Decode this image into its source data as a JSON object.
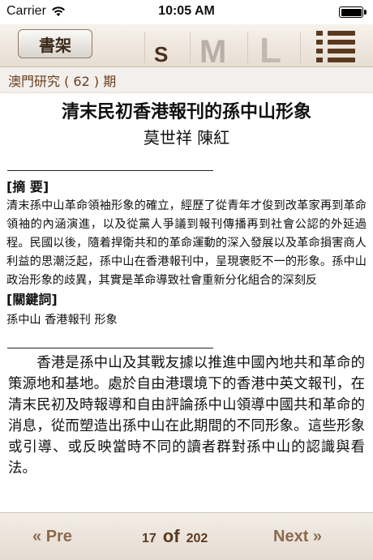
{
  "status": {
    "carrier": "Carrier",
    "time": "10:05 AM"
  },
  "toolbar": {
    "shelf_label": "書架",
    "size_small": "S",
    "size_medium": "M",
    "size_large": "L"
  },
  "breadcrumb": "澳門研究 ( 62 ) 期",
  "article": {
    "title": "清末民初香港報刊的孫中山形象",
    "authors": "莫世祥  陳紅",
    "abstract_heading": "[摘  要]",
    "abstract": "清末孫中山革命領袖形象的確立，經歷了從青年才俊到改革家再到革命領袖的內涵演進，以及從黨人爭議到報刊傳播再到社會公認的外延過程。民國以後，隨着捍衛共和的革命運動的深入發展以及革命損害商人利益的思潮泛起，孫中山在香港報刊中，呈現褒貶不一的形象。孫中山政治形象的歧異，其實是革命導致社會重新分化組合的深刻反",
    "keywords_heading": "[關鍵詞]",
    "keywords": "孫中山  香港報刊  形象",
    "body": "香港是孫中山及其戰友據以推進中國內地共和革命的策源地和基地。處於自由港環境下的香港中英文報刊，在清末民初及時報導和自由評論孫中山領導中國共和革命的消息，從而塑造出孫中山在此期間的不同形象。這些形象或引導、或反映當時不同的讀者群對孫中山的認識與看法。"
  },
  "footer": {
    "prev_label": "Pre",
    "next_label": "Next",
    "current_page": "17",
    "of_label": "of",
    "total_pages": "202"
  },
  "colors": {
    "accent_brown": "#5a3a1f",
    "nav_brown": "#8b6a4d"
  }
}
